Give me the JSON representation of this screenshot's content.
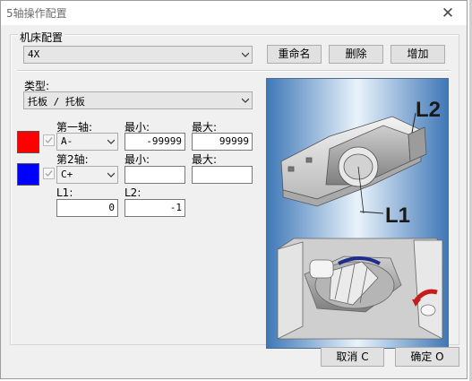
{
  "window": {
    "title": "5轴操作配置",
    "close_glyph": "✕"
  },
  "machine_config": {
    "group_label": "机床配置",
    "selected": "4X",
    "rename_label": "重命名",
    "delete_label": "删除",
    "add_label": "增加"
  },
  "type": {
    "label": "类型:",
    "selected": "托板 / 托板"
  },
  "axis1": {
    "color": "#ff0000",
    "label": "第一轴:",
    "value": "A-",
    "min_label": "最小:",
    "min_value": "-99999",
    "max_label": "最大:",
    "max_value": "99999"
  },
  "axis2": {
    "color": "#0000ff",
    "label": "第2轴:",
    "value": "C+",
    "min_label": "最小:",
    "min_value": "",
    "max_label": "最大:",
    "max_value": ""
  },
  "l1": {
    "label": "L1:",
    "value": "0"
  },
  "l2": {
    "label": "L2:",
    "value": "-1"
  },
  "illustration": {
    "label_l2": "L2",
    "label_l1": "L1",
    "icon": "trunnion-table-illustration"
  },
  "buttons": {
    "cancel_label": "取消 C",
    "ok_label": "确定 O"
  }
}
